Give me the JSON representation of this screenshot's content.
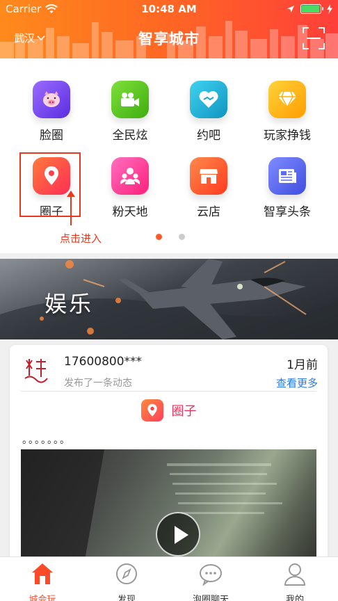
{
  "status": {
    "carrier": "Carrier",
    "time": "10:48 AM",
    "battery_level": 0.95
  },
  "nav": {
    "city": "武汉",
    "title": "智享城市"
  },
  "grid": {
    "items": [
      {
        "label": "脸圈",
        "icon": "pig-icon",
        "color": "#7b4dff"
      },
      {
        "label": "全民炫",
        "icon": "video-camera-icon",
        "color": "#5ec71a"
      },
      {
        "label": "约吧",
        "icon": "heart-handshake-icon",
        "color": "#1db8d6"
      },
      {
        "label": "玩家挣钱",
        "icon": "diamond-icon",
        "color": "#ffb300"
      },
      {
        "label": "圈子",
        "icon": "location-pin-icon",
        "color": "#ff3e4d"
      },
      {
        "label": "粉天地",
        "icon": "people-icon",
        "color": "#ff3f9e"
      },
      {
        "label": "云店",
        "icon": "store-icon",
        "color": "#ff5f2e"
      },
      {
        "label": "智享头条",
        "icon": "newspaper-icon",
        "color": "#5a6cf0"
      }
    ],
    "tip": "点击进入",
    "pages": 2,
    "active_page": 1
  },
  "banner": {
    "title": "娱乐"
  },
  "post": {
    "user": "17600800***",
    "time": "1月前",
    "subtitle": "发布了一条动态",
    "more": "查看更多",
    "tag": "圈子",
    "text": "。。。。。。。"
  },
  "tabbar": {
    "tabs": [
      {
        "label": "城会玩",
        "icon": "home-icon",
        "active": true
      },
      {
        "label": "发现",
        "icon": "compass-icon",
        "active": false
      },
      {
        "label": "泡圈聊天",
        "icon": "chat-bubble-icon",
        "active": false
      },
      {
        "label": "我的",
        "icon": "user-icon",
        "active": false
      }
    ]
  },
  "colors": {
    "accent": "#ff4a2a",
    "link": "#2e7ae0",
    "tag": "#f0315d"
  }
}
